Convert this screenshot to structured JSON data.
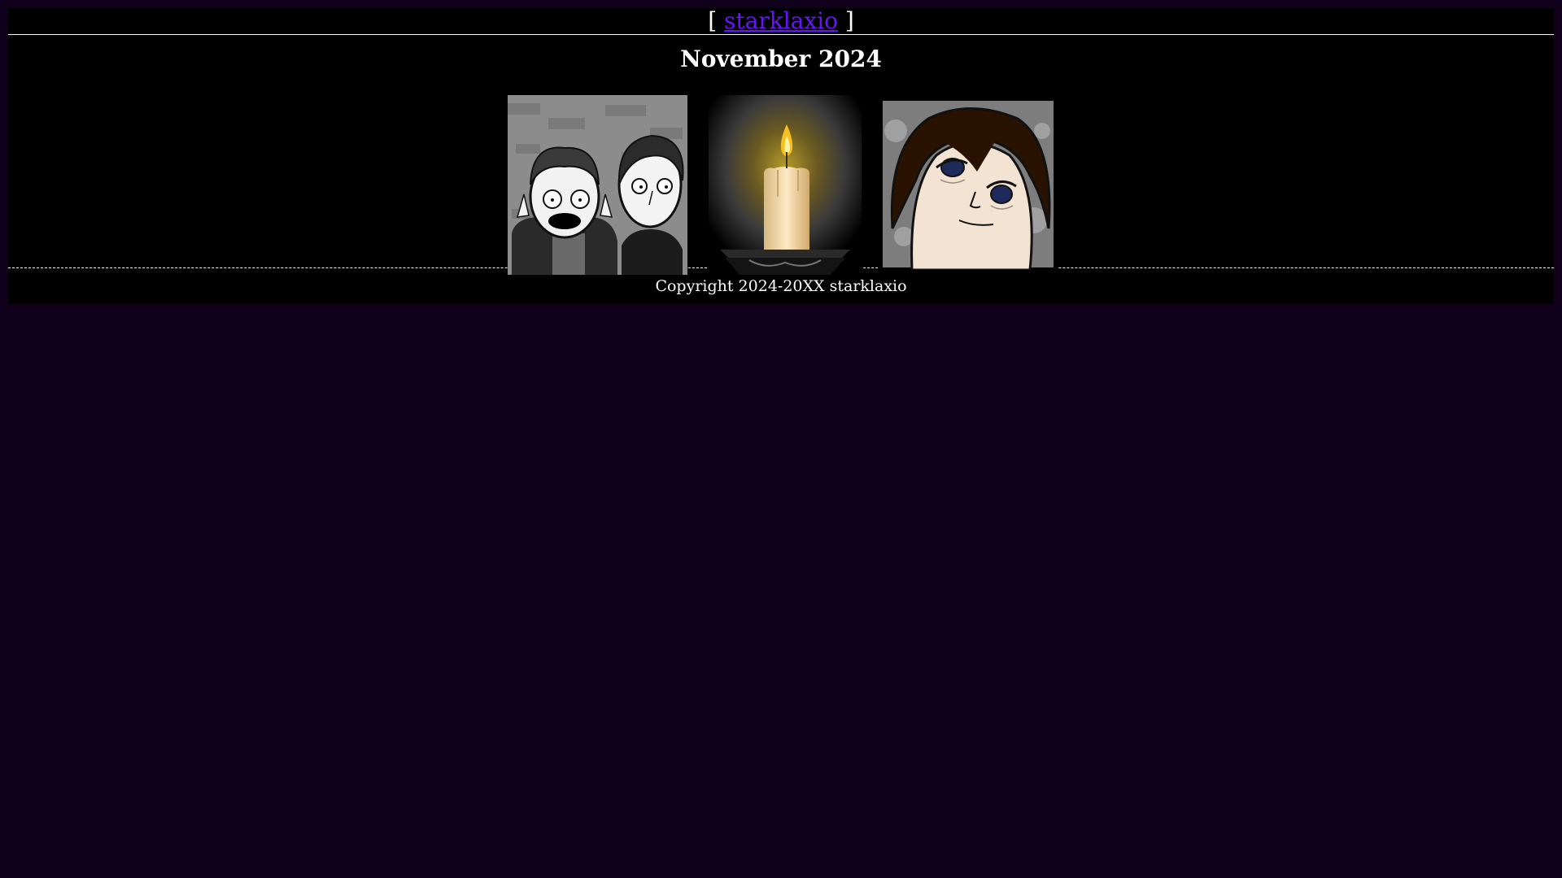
{
  "header": {
    "bracket_open": "[",
    "site_link": "starklaxio",
    "bracket_close": "]"
  },
  "month_title": "November 2024",
  "gallery": {
    "items": [
      {
        "icon": "screaming-characters-thumbnail"
      },
      {
        "icon": "candle-thumbnail"
      },
      {
        "icon": "tired-face-thumbnail"
      }
    ]
  },
  "footer": {
    "copyright": "Copyright 2024-20XX starklaxio"
  },
  "colors": {
    "body_bg": "#11001c",
    "panel_bg": "#000000",
    "link": "#6a12ff",
    "text": "#ffffff"
  }
}
